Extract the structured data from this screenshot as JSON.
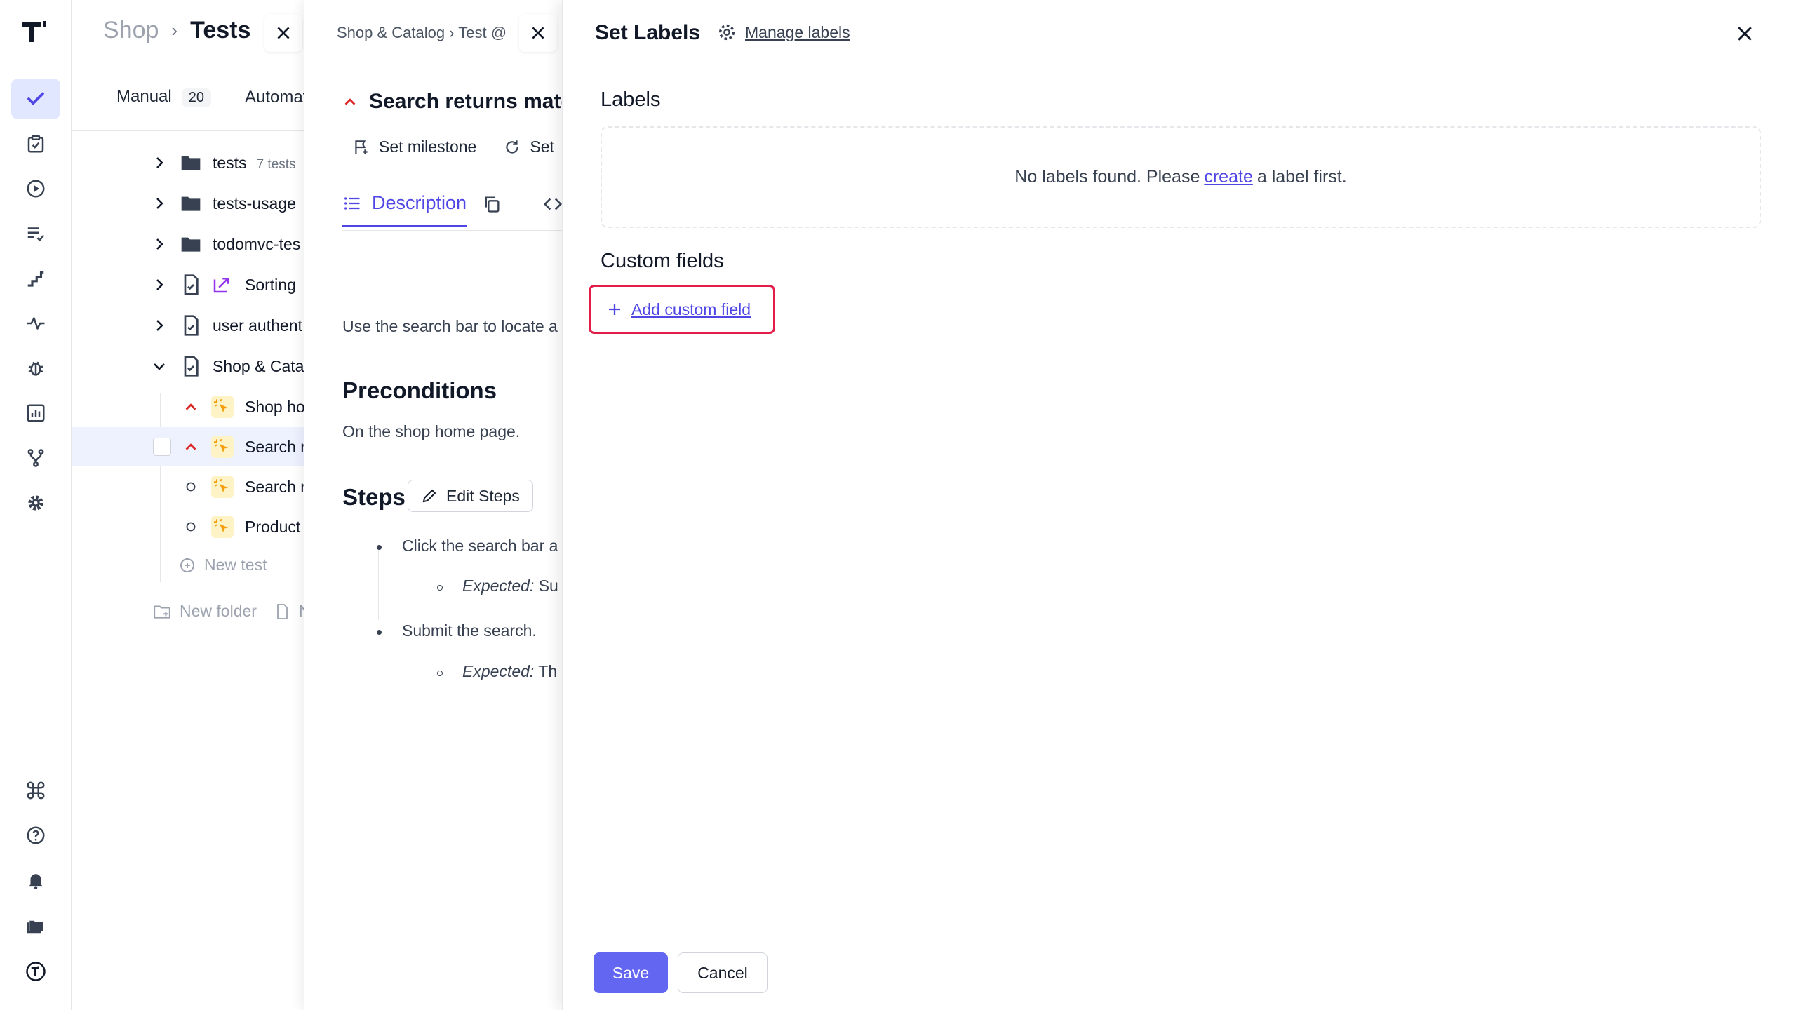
{
  "rail": {
    "icons": [
      "logo-icon",
      "check-icon",
      "clipboard-check-icon",
      "play-icon",
      "list-check-icon",
      "stairs-icon",
      "pulse-icon",
      "bug-icon",
      "chart-icon",
      "branch-icon",
      "gear-icon",
      "command-icon",
      "help-icon",
      "bell-icon",
      "folders-icon",
      "profile-logo-icon"
    ]
  },
  "tree": {
    "breadcrumb_project": "Shop",
    "breadcrumb_sep": "›",
    "breadcrumb_page": "Tests",
    "tab_manual": "Manual",
    "tab_manual_count": "20",
    "tab_automated": "Automat",
    "rows": [
      {
        "label": "tests",
        "count": "7 tests"
      },
      {
        "label": "tests-usage"
      },
      {
        "label": "todomvc-tes"
      },
      {
        "label": "Sorting"
      },
      {
        "label": "user authent"
      },
      {
        "label": "Shop & Cata"
      }
    ],
    "tests": [
      {
        "label": "Shop ho"
      },
      {
        "label": "Search r"
      },
      {
        "label": "Search r"
      },
      {
        "label": "Product"
      }
    ],
    "new_test": "New test",
    "new_folder": "New folder",
    "new_file_cut": "N"
  },
  "detail": {
    "breadcrumb": "Shop & Catalog  ›  Test @",
    "title": "Search returns matc",
    "set_milestone": "Set milestone",
    "set_cut": "Set",
    "tab_description": "Description",
    "description_text": "Use the search bar to locate a",
    "preconditions_heading": "Preconditions",
    "preconditions_text": "On the shop home page.",
    "steps_heading": "Steps",
    "edit_steps": "Edit Steps",
    "step1": "Click the search bar a",
    "step1_expected_label": "Expected:",
    "step1_expected": "Su",
    "step2": "Submit the search.",
    "step2_expected_label": "Expected:",
    "step2_expected": "Th"
  },
  "drawer": {
    "title": "Set Labels",
    "manage_labels": "Manage labels",
    "labels_heading": "Labels",
    "empty_before": "No labels found. Please",
    "empty_link": "create",
    "empty_after": "a label first.",
    "custom_fields_heading": "Custom fields",
    "add_custom_field": "Add custom field",
    "save": "Save",
    "cancel": "Cancel"
  },
  "colors": {
    "accent": "#4f46e5",
    "primary_button": "#6366f1",
    "highlight_border": "#e11d48",
    "priority_red": "#dc2626",
    "selected_row": "#eef2ff"
  }
}
